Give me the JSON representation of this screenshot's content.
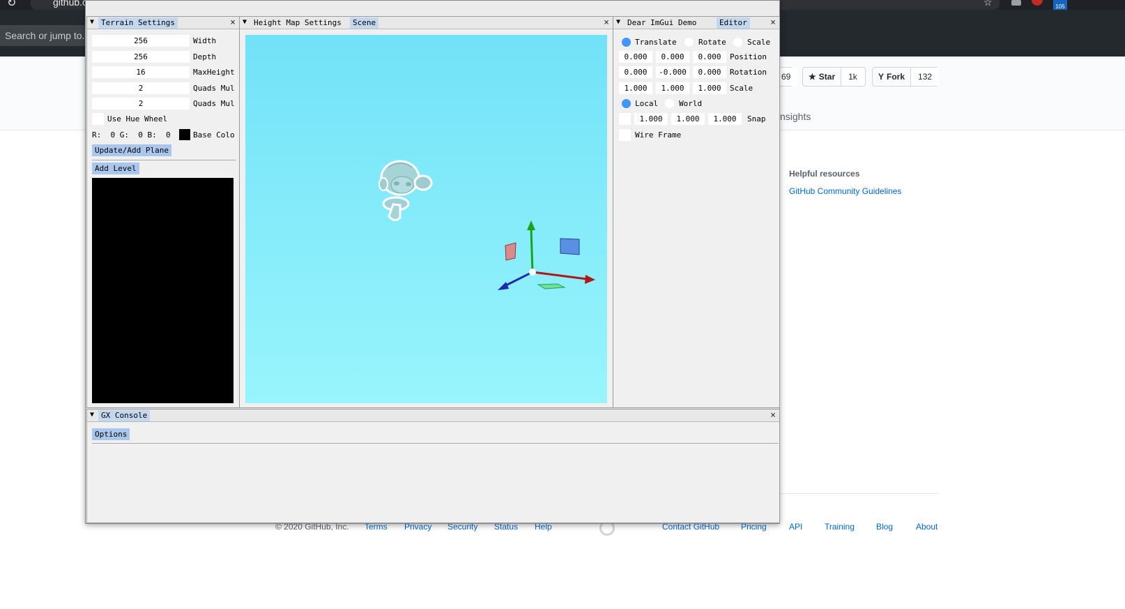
{
  "browser": {
    "url_fragment": "github.c",
    "ext_badge": "105"
  },
  "github": {
    "search_placeholder": "Search or jump to...",
    "watch_count_fragment": "69",
    "star_label": "Star",
    "star_count": "1k",
    "fork_label": "Fork",
    "fork_count": "132",
    "insights_fragment": "nsights",
    "helpful_title": "Helpful resources",
    "helpful_link": "GitHub Community Guidelines",
    "footer": {
      "copyright": "© 2020 GitHub, Inc.",
      "links": [
        "Terms",
        "Privacy",
        "Security",
        "Status",
        "Help",
        "Contact GitHub",
        "Pricing",
        "API",
        "Training",
        "Blog",
        "About"
      ]
    }
  },
  "terrain": {
    "tab": "Terrain Settings",
    "fields": [
      {
        "value": "256",
        "label": "Width"
      },
      {
        "value": "256",
        "label": "Depth"
      },
      {
        "value": "16",
        "label": "MaxHeight"
      },
      {
        "value": "2",
        "label": "Quads Mul"
      },
      {
        "value": "2",
        "label": "Quads Mul"
      }
    ],
    "hue_wheel_label": "Use Hue Wheel",
    "color_row": "R:  0 G:  0 B:  0",
    "base_color_label": "Base Colo",
    "update_button": "Update/Add Plane",
    "add_level_button": "Add Level"
  },
  "heightmap": {
    "tab_inactive": "Height Map Settings",
    "tab_active": "Scene"
  },
  "editor": {
    "tab_inactive": "Dear ImGui Demo",
    "tab_active": "Editor",
    "operations": [
      {
        "label": "Translate",
        "selected": true
      },
      {
        "label": "Rotate",
        "selected": false
      },
      {
        "label": "Scale",
        "selected": false
      }
    ],
    "position": {
      "values": [
        "0.000",
        "0.000",
        "0.000"
      ],
      "label": "Position"
    },
    "rotation": {
      "values": [
        "0.000",
        "-0.000",
        "0.000"
      ],
      "label": "Rotation"
    },
    "scale": {
      "values": [
        "1.000",
        "1.000",
        "1.000"
      ],
      "label": "Scale"
    },
    "modes": [
      {
        "label": "Local",
        "selected": true
      },
      {
        "label": "World",
        "selected": false
      }
    ],
    "snap": {
      "values": [
        "1.000",
        "1.000",
        "1.000"
      ],
      "label": "Snap"
    },
    "wireframe_label": "Wire Frame"
  },
  "console": {
    "tab": "GX Console",
    "options_button": "Options"
  },
  "icons": {
    "collapse": "▼",
    "close": "×",
    "star": "★",
    "fork": "Y"
  },
  "colors": {
    "imgui_tab_active": "#c3d7ef",
    "imgui_button": "#a9c6ed",
    "imgui_radio_on": "#4296fa",
    "viewport_top": "#72e2f8",
    "viewport_bottom": "#98f5fc"
  }
}
